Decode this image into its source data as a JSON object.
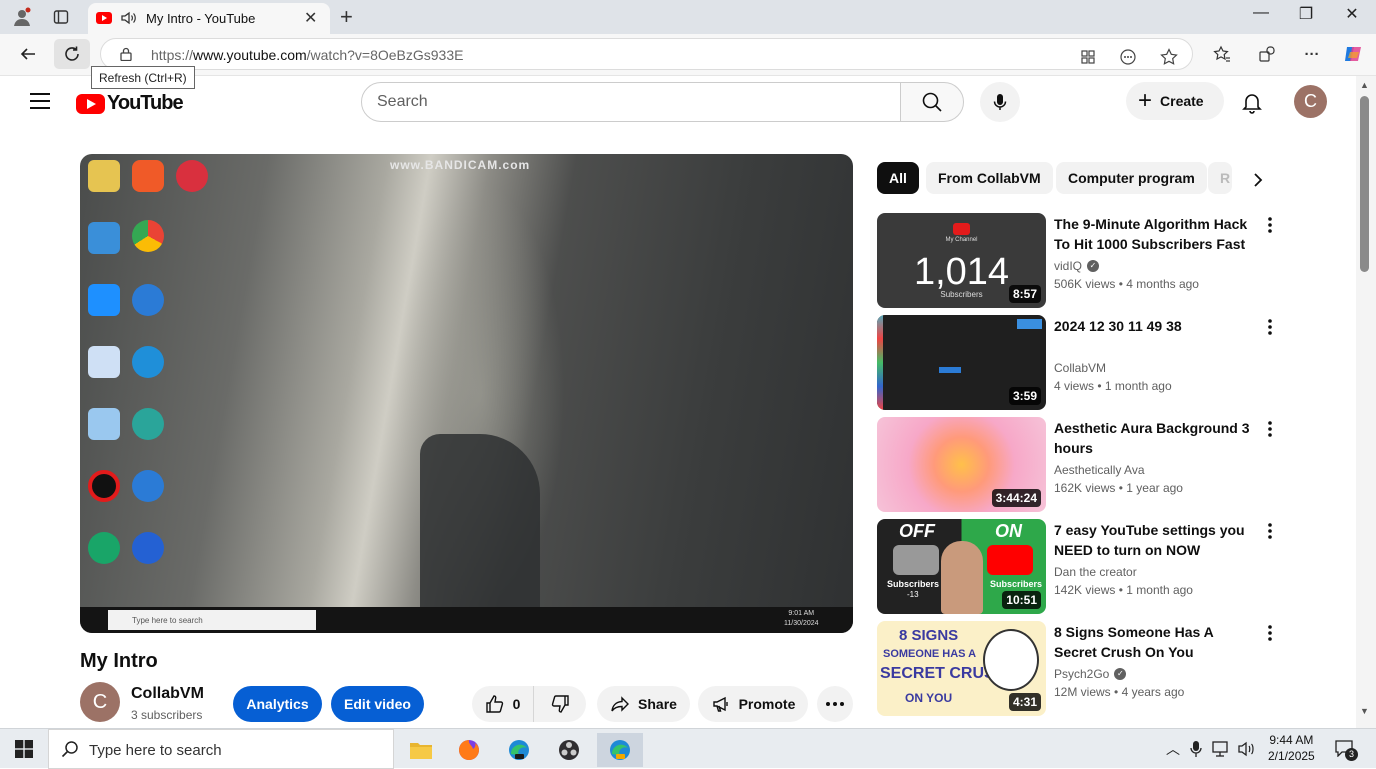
{
  "browser": {
    "tab_title": "My Intro - YouTube",
    "url_prefix": "https://",
    "url_domain": "www.youtube.com",
    "url_path": "/watch?v=8OeBzGs933E",
    "tooltip": "Refresh (Ctrl+R)",
    "new_tab_glyph": "+",
    "close_glyph": "✕",
    "minimize_glyph": "—",
    "restore_glyph": "❐",
    "window_close_glyph": "✕",
    "more_glyph": "···"
  },
  "youtube": {
    "logo_text": "YouTube",
    "search_placeholder": "Search",
    "create_label": "Create",
    "avatar_letter": "C"
  },
  "video": {
    "title": "My Intro",
    "watermark": "www.BANDICAM.com",
    "inner_taskbar_search": "Type here to search",
    "inner_clock_time": "9:01 AM",
    "inner_clock_date": "11/30/2024",
    "channel_name": "CollabVM",
    "channel_avatar_letter": "C",
    "subscribers": "3 subscribers",
    "analytics_label": "Analytics",
    "edit_label": "Edit video",
    "like_count": "0",
    "share_label": "Share",
    "promote_label": "Promote"
  },
  "chips": [
    "All",
    "From CollabVM",
    "Computer program",
    "R"
  ],
  "suggestions": [
    {
      "title": "The 9-Minute Algorithm Hack To Hit 1000 Subscribers Fast",
      "channel": "vidIQ",
      "verified": true,
      "views": "506K views",
      "age": "4 months ago",
      "duration": "8:57",
      "thumb_text": "1,014",
      "thumb_sub": "Subscribers",
      "thumb_top": "My Channel"
    },
    {
      "title": "2024 12 30 11 49 38",
      "channel": "CollabVM",
      "verified": false,
      "views": "4 views",
      "age": "1 month ago",
      "duration": "3:59"
    },
    {
      "title": "Aesthetic Aura Background 3 hours",
      "channel": "Aesthetically Ava",
      "verified": false,
      "views": "162K views",
      "age": "1 year ago",
      "duration": "3:44:24"
    },
    {
      "title": "7 easy YouTube settings you NEED to turn on NOW",
      "channel": "Dan the creator",
      "verified": false,
      "views": "142K views",
      "age": "1 month ago",
      "duration": "10:51",
      "thumb_off": "OFF",
      "thumb_on": "ON",
      "thumb_sub": "Subscribers",
      "thumb_neg": "-13"
    },
    {
      "title": "8 Signs Someone Has A Secret Crush On You",
      "channel": "Psych2Go",
      "verified": true,
      "views": "12M views",
      "age": "4 years ago",
      "duration": "4:31",
      "thumb_l1": "8 SIGNS",
      "thumb_l2": "SOMEONE HAS A",
      "thumb_l3": "SECRET CRUSH",
      "thumb_l4": "ON YOU"
    }
  ],
  "meta_separator": "•",
  "taskbar": {
    "search_text": "Type here to search",
    "time": "9:44 AM",
    "date": "2/1/2025",
    "notifications": "3"
  },
  "colors": {
    "yt_red": "#ff0000",
    "button_blue": "#065fd4",
    "chip_gray": "#f2f2f2",
    "text_secondary": "#606060",
    "avatar_bg": "#9c7266"
  }
}
